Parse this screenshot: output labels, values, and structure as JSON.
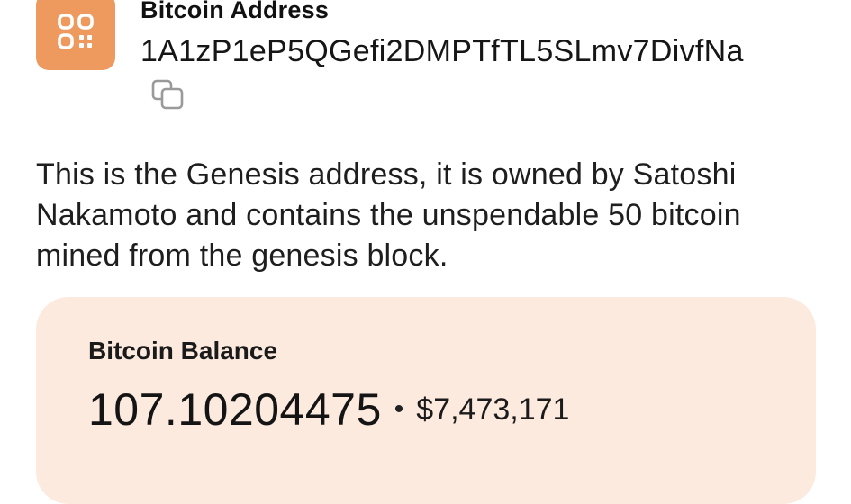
{
  "address": {
    "icon": "qr-code-icon",
    "label": "Bitcoin Address",
    "value": "1A1zP1eP5QGefi2DMPTfTL5SLmv7DivfNa",
    "copy_icon": "copy-icon"
  },
  "description": "This is the Genesis address, it is owned by Satoshi Nakamoto and contains the unspendable 50 bitcoin mined from the genesis block.",
  "balance": {
    "label": "Bitcoin Balance",
    "btc": "107.10204475",
    "separator": "•",
    "usd": "$7,473,171"
  },
  "colors": {
    "icon_tile": "#ee9a5f",
    "card_background": "#fdeadf"
  }
}
